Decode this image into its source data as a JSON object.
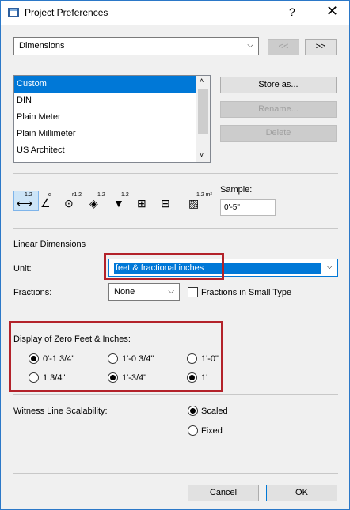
{
  "window": {
    "title": "Project Preferences",
    "help_label": "?",
    "close_label": "✕"
  },
  "top": {
    "category": "Dimensions",
    "prev_label": "<<",
    "next_label": ">>"
  },
  "presets": {
    "items": [
      "Custom",
      "DIN",
      "Plain Meter",
      "Plain Millimeter",
      "US Architect"
    ],
    "selected": "Custom",
    "store_label": "Store as...",
    "rename_label": "Rename...",
    "delete_label": "Delete"
  },
  "tools": {
    "icons": [
      "linear-dimension-icon",
      "angle-dimension-icon",
      "radial-dimension-icon",
      "level-dimension-icon",
      "elevation-dimension-icon",
      "door-window-dimension-icon",
      "sill-height-dimension-icon",
      "area-dimension-icon"
    ],
    "icon_labels": [
      "1.2",
      "α",
      "r1.2",
      "1.2",
      "1.2",
      "",
      "",
      "1.2 m²"
    ]
  },
  "sample": {
    "label": "Sample:",
    "value": "0'-5\""
  },
  "linear": {
    "section_label": "Linear Dimensions",
    "unit_label": "Unit:",
    "unit_value": "feet & fractional inches",
    "fractions_label": "Fractions:",
    "fractions_value": "None",
    "small_type_label": "Fractions in Small Type"
  },
  "zero": {
    "label": "Display of Zero Feet & Inches:",
    "options": [
      {
        "label": "0'-1 3/4\"",
        "checked": true
      },
      {
        "label": "1'-0 3/4\"",
        "checked": false
      },
      {
        "label": "1'-0\"",
        "checked": false
      },
      {
        "label": "1 3/4\"",
        "checked": false
      },
      {
        "label": "1'-3/4\"",
        "checked": true
      },
      {
        "label": "1'",
        "checked": true
      }
    ]
  },
  "witness": {
    "label": "Witness Line Scalability:",
    "options": [
      {
        "label": "Scaled",
        "checked": true
      },
      {
        "label": "Fixed",
        "checked": false
      }
    ]
  },
  "footer": {
    "cancel_label": "Cancel",
    "ok_label": "OK"
  },
  "colors": {
    "selection": "#0078d7",
    "highlight_box": "#b3222a"
  }
}
